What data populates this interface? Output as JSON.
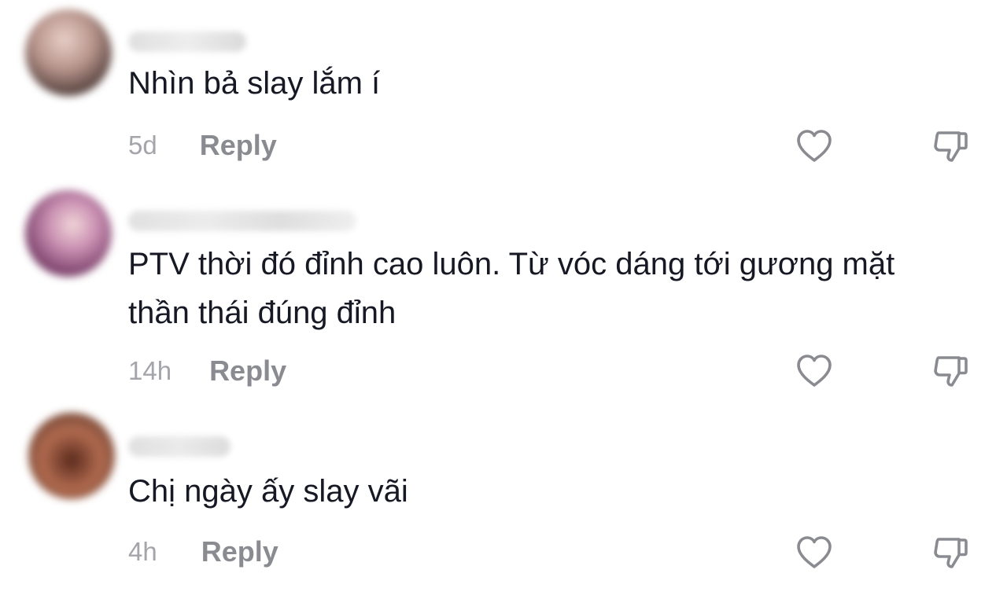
{
  "colors": {
    "text": "#161823",
    "time": "#a4a5ab",
    "reply": "#8a8b91",
    "icon": "#8a8b91"
  },
  "comments": [
    {
      "text": "Nhìn bả slay lắm í",
      "time": "5d",
      "reply_label": "Reply",
      "avatar_colors": [
        "#d9b9b2",
        "#3b2b29"
      ],
      "like_icon": "heart-outline-icon",
      "dislike_icon": "thumbs-down-outline-icon"
    },
    {
      "text": "PTV thời đó đỉnh cao luôn. Từ vóc dáng tới gương mặt thần thái đúng đỉnh",
      "time": "14h",
      "reply_label": "Reply",
      "avatar_colors": [
        "#c98fb2",
        "#5a2b4a"
      ],
      "like_icon": "heart-outline-icon",
      "dislike_icon": "thumbs-down-outline-icon"
    },
    {
      "text": "Chị ngày ấy slay vãi",
      "time": "4h",
      "reply_label": "Reply",
      "avatar_colors": [
        "#b06a4f",
        "#3a1f16"
      ],
      "like_icon": "heart-outline-icon",
      "dislike_icon": "thumbs-down-outline-icon"
    }
  ]
}
